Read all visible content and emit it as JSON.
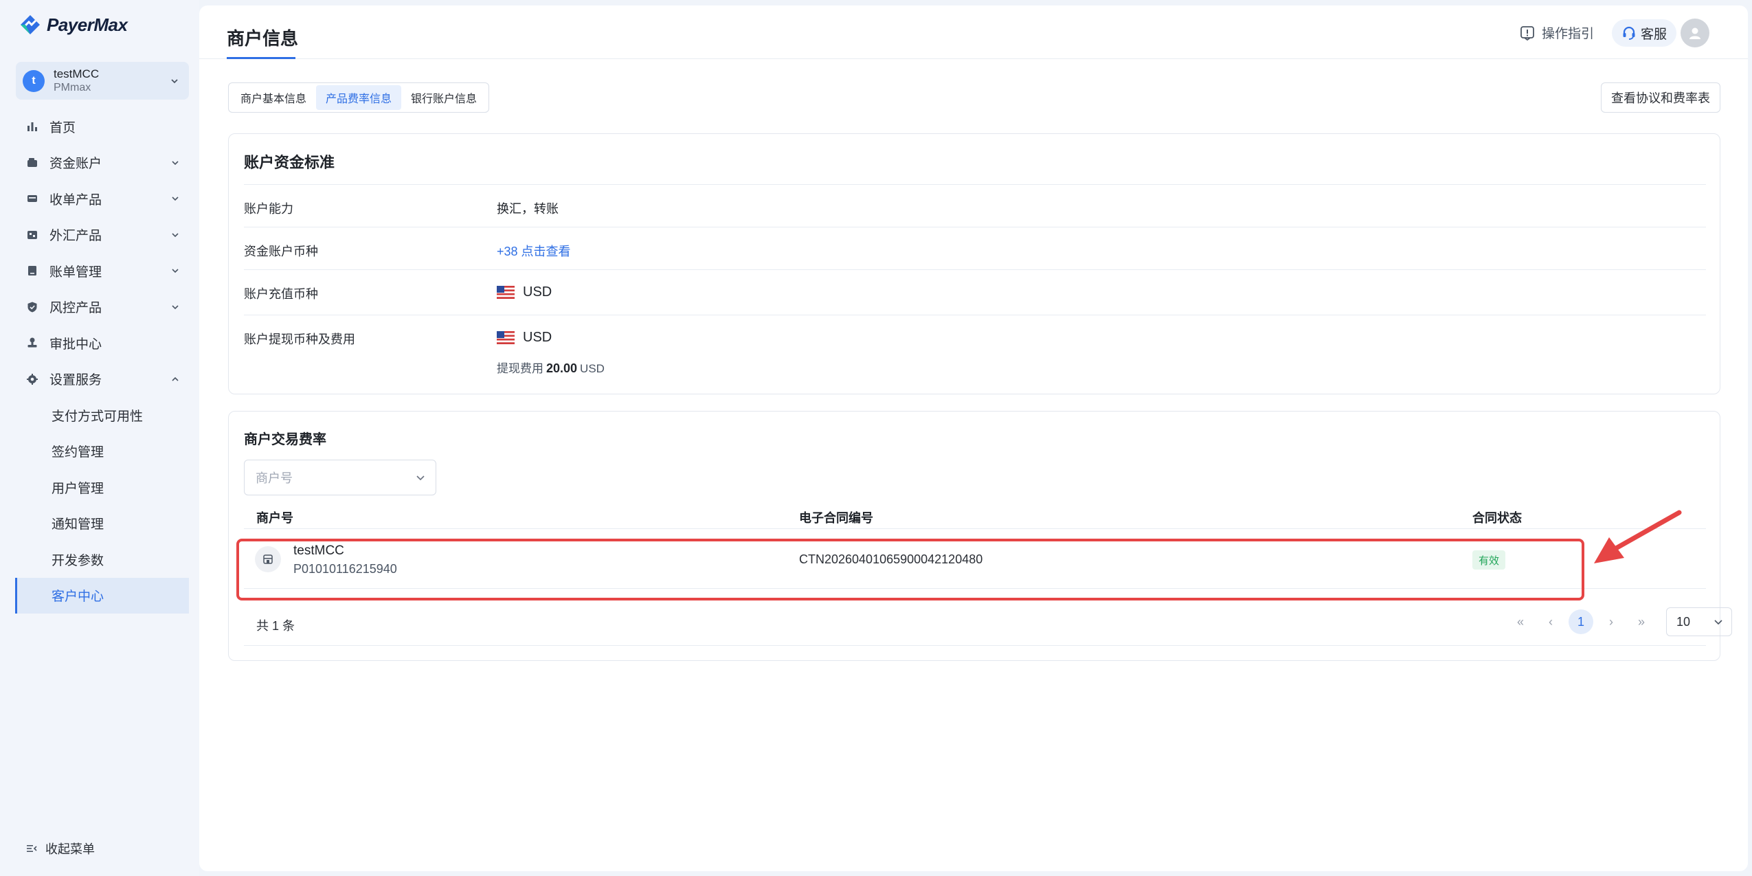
{
  "brand": {
    "name": "PayerMax"
  },
  "account": {
    "initial": "t",
    "name": "testMCC",
    "sub": "PMmax"
  },
  "menu": {
    "home": "首页",
    "fund_account": "资金账户",
    "collection_products": "收单产品",
    "fx_products": "外汇产品",
    "bill_management": "账单管理",
    "risk_products": "风控产品",
    "approval_center": "审批中心",
    "settings": "设置服务",
    "sub": {
      "payment_availability": "支付方式可用性",
      "contract_management": "签约管理",
      "user_management": "用户管理",
      "notification_management": "通知管理",
      "dev_params": "开发参数",
      "customer_center": "客户中心"
    },
    "collapse": "收起菜单"
  },
  "header": {
    "title": "商户信息",
    "guide": "操作指引",
    "support": "客服"
  },
  "tabs": {
    "basic": "商户基本信息",
    "fees": "产品费率信息",
    "bank": "银行账户信息"
  },
  "view_agreement": "查看协议和费率表",
  "account_standard": {
    "title": "账户资金标准",
    "capability_label": "账户能力",
    "capability_value": "换汇，转账",
    "currency_label": "资金账户币种",
    "currency_link": "+38 点击查看",
    "topup_label": "账户充值币种",
    "topup_value": "USD",
    "withdraw_label": "账户提现币种及费用",
    "withdraw_value": "USD",
    "fee_prefix": "提现费用",
    "fee_amount": "20.00",
    "fee_currency": "USD"
  },
  "rates": {
    "title": "商户交易费率",
    "select_placeholder": "商户号",
    "columns": {
      "merchant": "商户号",
      "contract": "电子合同编号",
      "status": "合同状态"
    },
    "rows": [
      {
        "merchant_name": "testMCC",
        "merchant_id": "P01010116215940",
        "contract_no": "CTN20260401065900042120480",
        "status": "有效"
      }
    ],
    "total": "共 1 条",
    "current_page": "1",
    "page_size": "10"
  },
  "colors": {
    "accent": "#2f6fe4",
    "status_green": "#22a559",
    "annotation_red": "#e64545"
  }
}
